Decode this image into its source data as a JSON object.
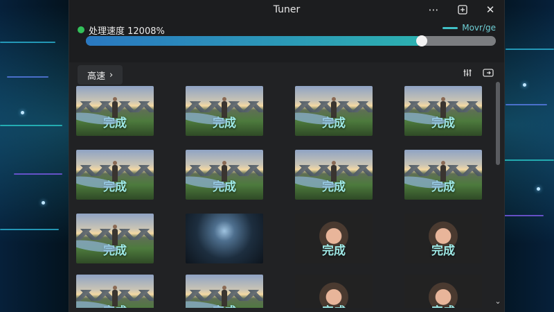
{
  "window": {
    "title": "Tuner"
  },
  "titlebar": {
    "more_icon": "more-icon",
    "pin_icon": "pin-icon",
    "close_icon": "close-icon"
  },
  "progress": {
    "status_text": "处理速度 12008%",
    "right_label": "Movr/ge",
    "fill_fraction": 0.82
  },
  "panel": {
    "speed_chip": "高速",
    "speed_chevron": "›",
    "filter_icon": "filter-icon",
    "export_icon": "export-icon"
  },
  "tiles": [
    {
      "label": "完成",
      "kind": "land"
    },
    {
      "label": "完成",
      "kind": "land"
    },
    {
      "label": "完成",
      "kind": "land"
    },
    {
      "label": "完成",
      "kind": "land"
    },
    {
      "label": "完成",
      "kind": "land"
    },
    {
      "label": "完成",
      "kind": "land"
    },
    {
      "label": "完成",
      "kind": "land"
    },
    {
      "label": "完成",
      "kind": "land"
    },
    {
      "label": "完成",
      "kind": "land"
    },
    {
      "label": "",
      "kind": "night"
    },
    {
      "label": "完成",
      "kind": "portrait"
    },
    {
      "label": "完成",
      "kind": "portrait"
    },
    {
      "label": "完成",
      "kind": "land"
    },
    {
      "label": "完成",
      "kind": "land"
    },
    {
      "label": "完成",
      "kind": "portrait"
    },
    {
      "label": "完成",
      "kind": "portrait"
    }
  ],
  "colors": {
    "accent": "#2cb0b0",
    "ok": "#33c05a"
  }
}
